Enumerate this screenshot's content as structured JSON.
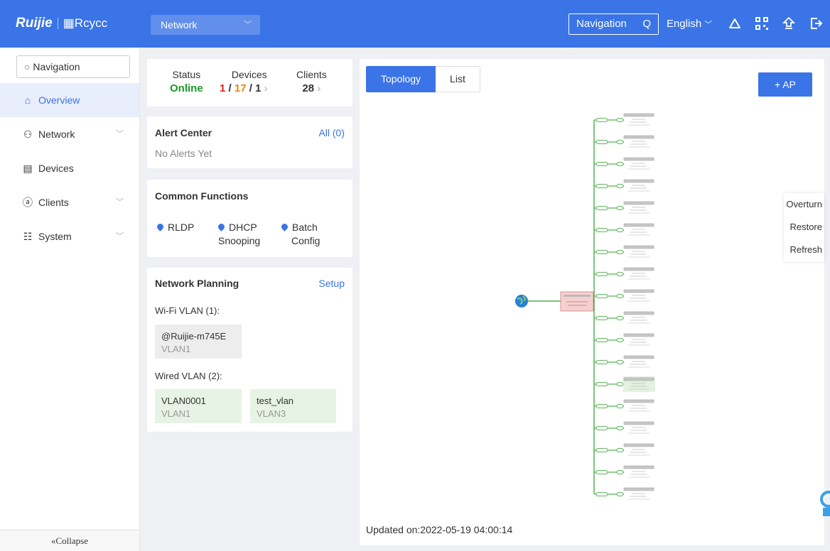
{
  "header": {
    "brand": "Ruijie",
    "brand_sub": "Rcycc",
    "network_select": "Network",
    "navigation_button": "Navigation",
    "language": "English",
    "icons": [
      "cloud-icon",
      "qr-code-icon",
      "upgrade-icon",
      "logout-icon"
    ],
    "accent": "#3a74e6"
  },
  "sidebar": {
    "search_label": "Navigation",
    "items": [
      {
        "label": "Overview",
        "icon": "home-icon",
        "active": true
      },
      {
        "label": "Network",
        "icon": "network-icon",
        "expandable": true
      },
      {
        "label": "Devices",
        "icon": "devices-icon"
      },
      {
        "label": "Clients",
        "icon": "clients-icon",
        "expandable": true
      },
      {
        "label": "System",
        "icon": "system-icon",
        "expandable": true
      }
    ],
    "collapse_label": "Collapse"
  },
  "status": {
    "status_label": "Status",
    "status_value": "Online",
    "devices_label": "Devices",
    "devices_a": "1",
    "devices_b": "17",
    "devices_c": "1",
    "clients_label": "Clients",
    "clients_value": "28",
    "online_color": "#1a9a2a",
    "red": "#e02020",
    "orange": "#f08010"
  },
  "alert_center": {
    "title": "Alert Center",
    "link": "All (0)",
    "message": "No Alerts Yet"
  },
  "common_functions": {
    "title": "Common Functions",
    "items": [
      {
        "line1": "RLDP",
        "line2": ""
      },
      {
        "line1": "DHCP",
        "line2": "Snooping"
      },
      {
        "line1": "Batch",
        "line2": "Config"
      }
    ]
  },
  "network_planning": {
    "title": "Network Planning",
    "link": "Setup",
    "wifi_label": "Wi-Fi VLAN (1):",
    "wifi_vlans": [
      {
        "name": "@Ruijie-m745E",
        "vlan": "VLAN1"
      }
    ],
    "wired_label": "Wired VLAN (2):",
    "wired_vlans": [
      {
        "name": "VLAN0001",
        "vlan": "VLAN1"
      },
      {
        "name": "test_vlan",
        "vlan": "VLAN3"
      }
    ]
  },
  "topology": {
    "tabs": [
      "Topology",
      "List"
    ],
    "add_ap": "+ AP",
    "controls": [
      "Overturn",
      "Restore",
      "Refresh"
    ],
    "updated": "Updated on:2022-05-19 04:00:14",
    "node_count": 18
  }
}
